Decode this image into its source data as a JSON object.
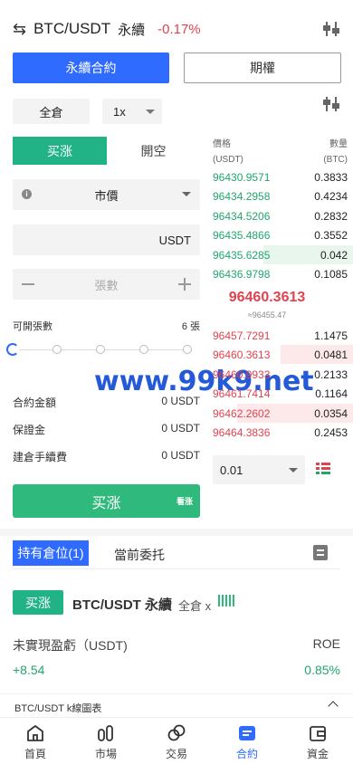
{
  "header": {
    "swap_icon": "swap-arrows-icon",
    "pair": "BTC/USDT",
    "kind": "永續",
    "change": "-0.17%",
    "change_color": "#e0434f"
  },
  "contract_tabs": {
    "perpetual": "永續合約",
    "futures": "期權"
  },
  "margin_mode": "全倉",
  "leverage": "1x",
  "order_side_tabs": {
    "buy": "买涨",
    "sell": "開空"
  },
  "order_type": "市價",
  "price_unit": "USDT",
  "quantity_placeholder": "張數",
  "openable": {
    "label": "可開張數",
    "value": "6 張"
  },
  "slider_percent": 0,
  "summary": [
    {
      "label": "合約金額",
      "value": "0 USDT"
    },
    {
      "label": "保證金",
      "value": "0 USDT"
    },
    {
      "label": "建倉手續費",
      "value": "0 USDT"
    }
  ],
  "buy_button": {
    "label": "买涨",
    "tag": "看涨"
  },
  "orderbook": {
    "header": {
      "price": "價格",
      "price_unit": "(USDT)",
      "qty": "數量",
      "qty_unit": "(BTC)"
    },
    "asks": [
      {
        "price": "96430.9571",
        "qty": "0.3833",
        "depth": 0
      },
      {
        "price": "96434.2958",
        "qty": "0.4234",
        "depth": 0
      },
      {
        "price": "96434.5206",
        "qty": "0.2832",
        "depth": 0
      },
      {
        "price": "96435.4866",
        "qty": "0.3552",
        "depth": 0
      },
      {
        "price": "96435.6285",
        "qty": "0.042",
        "depth": 0.62
      },
      {
        "price": "96436.9798",
        "qty": "0.1085",
        "depth": 0
      }
    ],
    "mid_price": "96460.3613",
    "mid_sub": "≈96455.47",
    "bids": [
      {
        "price": "96457.7291",
        "qty": "1.1475",
        "depth": 0
      },
      {
        "price": "96460.3613",
        "qty": "0.0481",
        "depth": 0.5
      },
      {
        "price": "96460.9933",
        "qty": "0.2133",
        "depth": 0
      },
      {
        "price": "96461.7414",
        "qty": "0.1164",
        "depth": 0
      },
      {
        "price": "96462.2602",
        "qty": "0.0354",
        "depth": 0.8
      },
      {
        "price": "96464.3836",
        "qty": "0.2453",
        "depth": 0
      }
    ],
    "depth_step": "0.01"
  },
  "positions": {
    "tab_holding": "持有倉位(1)",
    "tab_orders": "當前委托",
    "side": "买涨",
    "pair": "BTC/USDT 永續",
    "mode": "全倉 x",
    "pnl_label": "未實現盈虧（USDT)",
    "roe_label": "ROE",
    "pnl_value": "+8.54",
    "roe_value": "0.85%"
  },
  "kline_label": "BTC/USDT k線圖表",
  "nav": [
    {
      "label": "首頁",
      "icon": "home-icon"
    },
    {
      "label": "市場",
      "icon": "market-icon"
    },
    {
      "label": "交易",
      "icon": "trade-icon"
    },
    {
      "label": "合約",
      "icon": "contract-icon"
    },
    {
      "label": "資金",
      "icon": "wallet-icon"
    }
  ],
  "watermark": "www.99k9.net"
}
